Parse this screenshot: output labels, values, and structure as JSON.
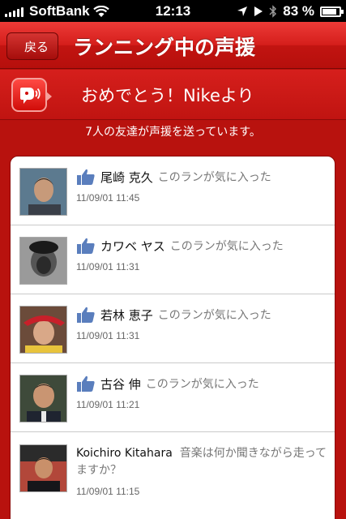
{
  "status": {
    "carrier": "SoftBank",
    "time": "12:13",
    "battery": "83 %",
    "battery_level": 0.83
  },
  "nav": {
    "back": "戻る",
    "title": "ランニング中の声援"
  },
  "banner": {
    "text": "おめでとう！Nikeより",
    "icon": "speech-sound-icon"
  },
  "subtitle": "7人の友達が声援を送っています。",
  "cheers": [
    {
      "name": "尾崎 克久",
      "message": "このランが気に入った",
      "date": "11/09/01  11:45",
      "type": "like"
    },
    {
      "name": "カワベ ヤス",
      "message": "このランが気に入った",
      "date": "11/09/01  11:31",
      "type": "like"
    },
    {
      "name": "若林 恵子",
      "message": "このランが気に入った",
      "date": "11/09/01  11:31",
      "type": "like"
    },
    {
      "name": "古谷 伸",
      "message": "このランが気に入った",
      "date": "11/09/01  11:21",
      "type": "like"
    },
    {
      "name": "Koichiro Kitahara",
      "message": "音楽は何か聞きながら走ってますか？",
      "date": "11/09/01  11:15",
      "type": "comment"
    }
  ],
  "colors": {
    "accent": "#c51613",
    "like_blue": "#5a7ebd"
  }
}
